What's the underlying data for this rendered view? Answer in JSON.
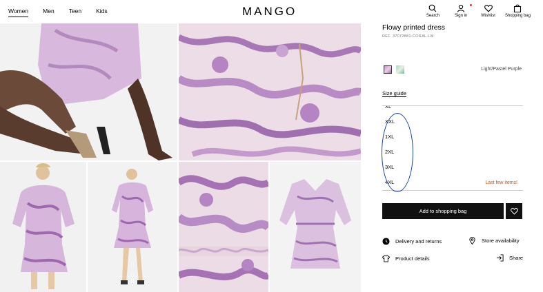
{
  "header": {
    "nav": [
      "Women",
      "Men",
      "Teen",
      "Kids"
    ],
    "logo": "MANGO",
    "icons": {
      "search": "Search",
      "signin": "Sign in",
      "wishlist": "Wishlist",
      "bag": "Shopping bag"
    }
  },
  "product": {
    "title": "Flowy printed dress",
    "ref": "REF. 37072881-CORAL-LM",
    "color_name": "Light/Pastel Purple",
    "size_guide": "Size guide",
    "sizes": [
      "XL",
      "XXL",
      "1XL",
      "2XL",
      "3XL",
      "4XL"
    ],
    "stock_notice": "Last few items!",
    "add_button": "Add to shopping bag",
    "delivery": "Delivery and returns",
    "store": "Store availability",
    "details": "Product details",
    "share": "Share"
  },
  "colors": {
    "accent_warning": "#c2531c",
    "annotation": "#1a3fa0",
    "button": "#111111"
  }
}
